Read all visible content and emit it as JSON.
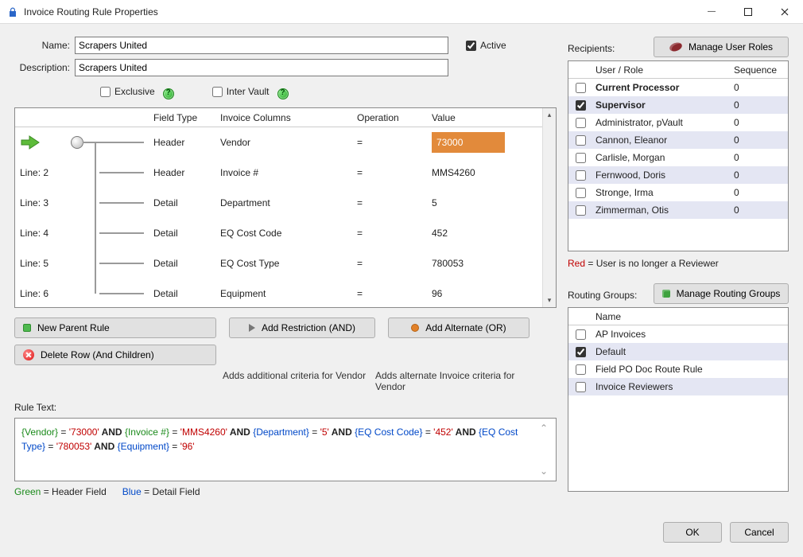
{
  "window": {
    "title": "Invoice Routing Rule Properties"
  },
  "form": {
    "name_label": "Name:",
    "name_value": "Scrapers United",
    "desc_label": "Description:",
    "desc_value": "Scrapers United",
    "active_label": "Active",
    "active_checked": true,
    "exclusive_label": "Exclusive",
    "intervault_label": "Inter Vault"
  },
  "grid": {
    "headers": {
      "fieldtype": "Field Type",
      "invoice_columns": "Invoice Columns",
      "operation": "Operation",
      "value": "Value"
    },
    "rows": [
      {
        "line": "",
        "fieldtype": "Header",
        "col": "Vendor",
        "op": "=",
        "value": "73000",
        "selected": true
      },
      {
        "line": "Line: 2",
        "fieldtype": "Header",
        "col": "Invoice #",
        "op": "=",
        "value": "MMS4260"
      },
      {
        "line": "Line: 3",
        "fieldtype": "Detail",
        "col": "Department",
        "op": "=",
        "value": "5"
      },
      {
        "line": "Line: 4",
        "fieldtype": "Detail",
        "col": "EQ Cost Code",
        "op": "=",
        "value": "452"
      },
      {
        "line": "Line: 5",
        "fieldtype": "Detail",
        "col": "EQ Cost Type",
        "op": "=",
        "value": "780053"
      },
      {
        "line": "Line: 6",
        "fieldtype": "Detail",
        "col": "Equipment",
        "op": "=",
        "value": "96"
      }
    ]
  },
  "buttons": {
    "new_parent": "New Parent Rule",
    "delete_row": "Delete Row (And Children)",
    "add_restriction": "Add Restriction (AND)",
    "add_alternate": "Add Alternate (OR)",
    "hint_restriction": "Adds additional criteria for Vendor",
    "hint_alternate": "Adds alternate Invoice criteria for Vendor"
  },
  "rule_text": {
    "label": "Rule Text:",
    "tokens": [
      {
        "t": "{Vendor}",
        "c": "g"
      },
      {
        "t": " = ",
        "c": ""
      },
      {
        "t": "'73000'",
        "c": "r"
      },
      {
        "t": " AND ",
        "c": "k"
      },
      {
        "t": "{Invoice #}",
        "c": "g"
      },
      {
        "t": " = ",
        "c": ""
      },
      {
        "t": "'MMS4260'",
        "c": "r"
      },
      {
        "t": " AND ",
        "c": "k"
      },
      {
        "t": "{Department}",
        "c": "b"
      },
      {
        "t": " = ",
        "c": ""
      },
      {
        "t": "'5'",
        "c": "r"
      },
      {
        "t": " AND ",
        "c": "k"
      },
      {
        "t": "{EQ Cost Code}",
        "c": "b"
      },
      {
        "t": " = ",
        "c": ""
      },
      {
        "t": "'452'",
        "c": "r"
      },
      {
        "t": " AND ",
        "c": "k"
      },
      {
        "t": "{EQ Cost Type}",
        "c": "b"
      },
      {
        "t": " = ",
        "c": ""
      },
      {
        "t": "'780053'",
        "c": "r"
      },
      {
        "t": " AND ",
        "c": "k"
      },
      {
        "t": "{Equipment}",
        "c": "b"
      },
      {
        "t": " = ",
        "c": ""
      },
      {
        "t": "'96'",
        "c": "r"
      }
    ],
    "legend_green": "Green",
    "legend_green_txt": " = Header Field",
    "legend_blue": "Blue",
    "legend_blue_txt": " = Detail Field"
  },
  "recipients": {
    "label": "Recipients:",
    "manage_btn": "Manage User Roles",
    "header_name": "User / Role",
    "header_seq": "Sequence",
    "rows": [
      {
        "checked": false,
        "name": "Current Processor",
        "seq": "0",
        "bold": true
      },
      {
        "checked": true,
        "name": "Supervisor",
        "seq": "0",
        "bold": true
      },
      {
        "checked": false,
        "name": "Administrator, pVault",
        "seq": "0"
      },
      {
        "checked": false,
        "name": "Cannon, Eleanor",
        "seq": "0"
      },
      {
        "checked": false,
        "name": "Carlisle, Morgan",
        "seq": "0"
      },
      {
        "checked": false,
        "name": "Fernwood, Doris",
        "seq": "0"
      },
      {
        "checked": false,
        "name": "Stronge, Irma",
        "seq": "0"
      },
      {
        "checked": false,
        "name": "Zimmerman, Otis",
        "seq": "0"
      }
    ],
    "note_red": "Red",
    "note_txt": "  = User is no longer a Reviewer"
  },
  "groups": {
    "label": "Routing Groups:",
    "manage_btn": "Manage Routing Groups",
    "header_name": "Name",
    "rows": [
      {
        "checked": false,
        "name": "AP Invoices"
      },
      {
        "checked": true,
        "name": "Default"
      },
      {
        "checked": false,
        "name": "Field PO Doc Route Rule"
      },
      {
        "checked": false,
        "name": "Invoice Reviewers"
      }
    ]
  },
  "footer": {
    "ok": "OK",
    "cancel": "Cancel"
  }
}
